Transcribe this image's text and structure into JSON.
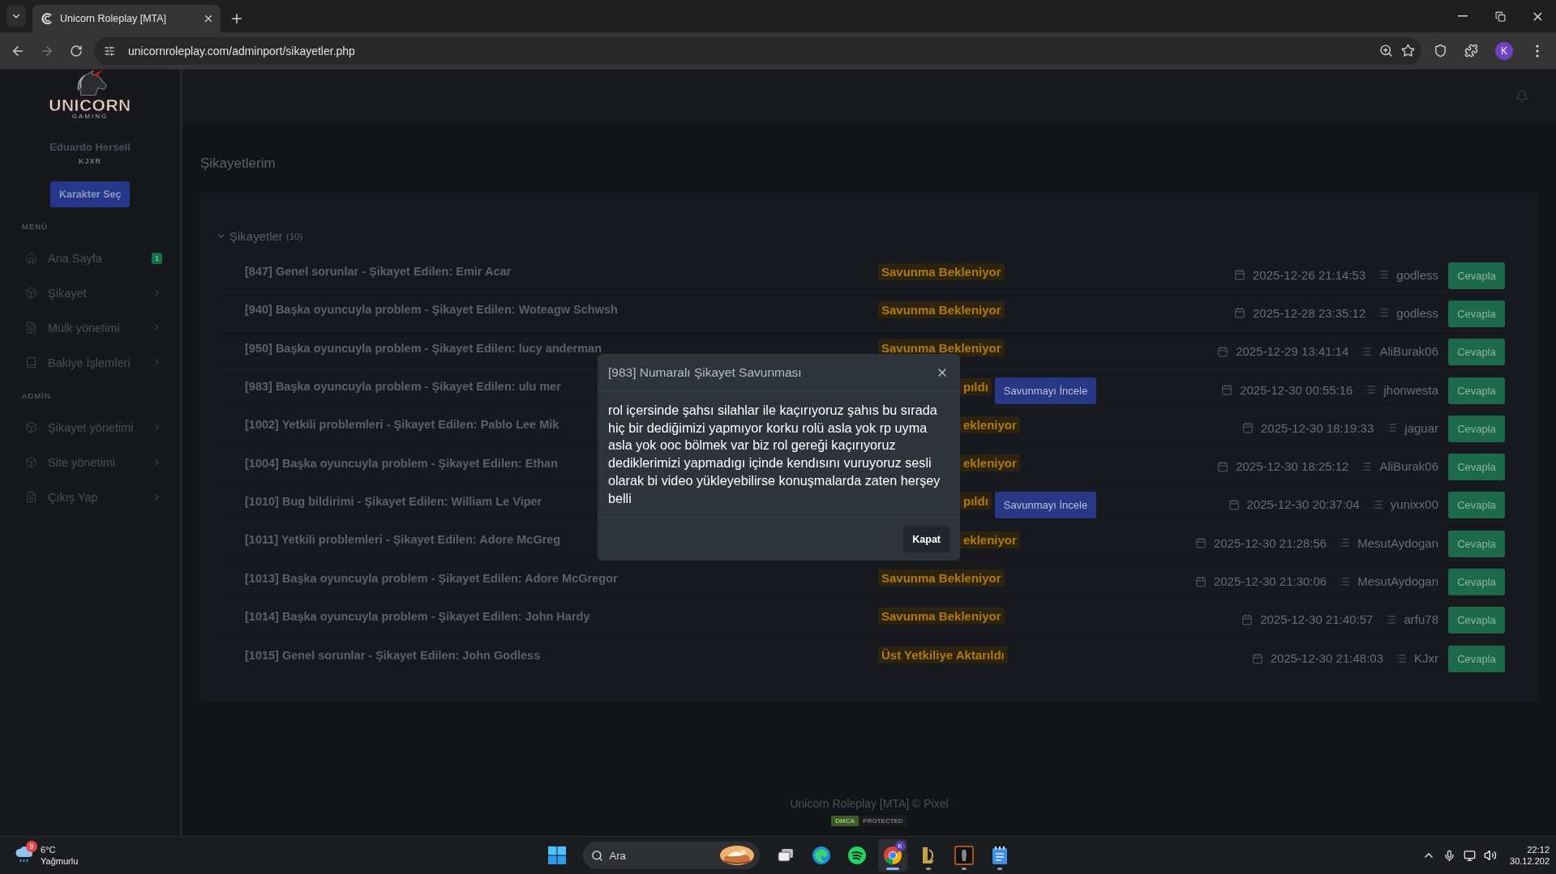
{
  "browser": {
    "tab_title": "Unicorn Roleplay [MTA]",
    "url": "unicornroleplay.com/adminport/sikayetler.php",
    "profile_initial": "K"
  },
  "sidebar": {
    "logo_text": "UNICORN",
    "logo_subtext": "GAMING",
    "user_name": "Eduardo Hersell",
    "user_tag": "KJXR",
    "select_button": "Karakter Seç",
    "sections": [
      {
        "heading": "MENÜ",
        "items": [
          {
            "label": "Ana Sayfa",
            "kind": "home",
            "badge": "1"
          },
          {
            "label": "Şikayet",
            "kind": "box"
          },
          {
            "label": "Mülk yönetimi",
            "kind": "file"
          },
          {
            "label": "Bakiye İşlemleri",
            "kind": "book"
          }
        ]
      },
      {
        "heading": "ADMİN",
        "items": [
          {
            "label": "Şikayet yönetimi",
            "kind": "box"
          },
          {
            "label": "Site yönetimi",
            "kind": "box"
          },
          {
            "label": "Çıkış Yap",
            "kind": "file"
          }
        ]
      }
    ]
  },
  "page_title": "Şikayetlerim",
  "complaints": {
    "heading": "Şikayetler",
    "count": "(10)",
    "expanded": true,
    "rows": [
      {
        "title": "[847] Genel sorunlar - Şikayet Edilen: Emir Acar",
        "status": "Savunma Bekleniyor",
        "status_clipped": false,
        "date": "2025-12-26 21:14:53",
        "user": "godless",
        "reply": "Cevapla"
      },
      {
        "title": "[940] Başka oyuncuyla problem - Şikayet Edilen: Woteagw Schwsh",
        "status": "Savunma Bekleniyor",
        "status_clipped": false,
        "date": "2025-12-28 23:35:12",
        "user": "godless",
        "reply": "Cevapla"
      },
      {
        "title": "[950] Başka oyuncuyla problem - Şikayet Edilen: lucy anderman",
        "status": "Savunma Bekleniyor",
        "status_clipped": false,
        "date": "2025-12-29 13:41:14",
        "user": "AliBurak06",
        "reply": "Cevapla"
      },
      {
        "title": "[983] Başka oyuncuyla problem - Şikayet Edilen: ulu mer",
        "status": "pıldı",
        "status_clipped": true,
        "action": "Savunmayı İncele",
        "date": "2025-12-30 00:55:16",
        "user": "jhonwesta",
        "reply": "Cevapla"
      },
      {
        "title": "[1002] Yetkili problemleri - Şikayet Edilen: Pablo Lee Mik",
        "status": "ekleniyor",
        "status_clipped": true,
        "date": "2025-12-30 18:19:33",
        "user": "jaguar",
        "reply": "Cevapla"
      },
      {
        "title": "[1004] Başka oyuncuyla problem - Şikayet Edilen: Ethan",
        "status": "ekleniyor",
        "status_clipped": true,
        "date": "2025-12-30 18:25:12",
        "user": "AliBurak06",
        "reply": "Cevapla"
      },
      {
        "title": "[1010] Bug bildirimi - Şikayet Edilen: William Le Viper",
        "status": "pıldı",
        "status_clipped": true,
        "action": "Savunmayı İncele",
        "date": "2025-12-30 20:37:04",
        "user": "yunixx00",
        "reply": "Cevapla"
      },
      {
        "title": "[1011] Yetkili problemleri - Şikayet Edilen: Adore McGreg",
        "status": "ekleniyor",
        "status_clipped": true,
        "date": "2025-12-30 21:28:56",
        "user": "MesutAydogan",
        "reply": "Cevapla"
      },
      {
        "title": "[1013] Başka oyuncuyla problem - Şikayet Edilen: Adore McGregor",
        "status": "Savunma Bekleniyor",
        "status_clipped": false,
        "date": "2025-12-30 21:30:06",
        "user": "MesutAydogan",
        "reply": "Cevapla"
      },
      {
        "title": "[1014] Başka oyuncuyla problem - Şikayet Edilen: John Hardy",
        "status": "Savunma Bekleniyor",
        "status_clipped": false,
        "date": "2025-12-30 21:40:57",
        "user": "arfu78",
        "reply": "Cevapla"
      },
      {
        "title": "[1015] Genel sorunlar - Şikayet Edilen: John Godless",
        "status": "Üst Yetkiliye Aktarıldı",
        "status_clipped": false,
        "date": "2025-12-30 21:48:03",
        "user": "KJxr",
        "reply": "Cevapla"
      }
    ]
  },
  "modal": {
    "title": "[983] Numaralı Şikayet Savunması",
    "body": "rol içersinde şahsı silahlar ile kaçırıyoruz şahıs bu sırada hiç bir dediğimizi yapmıyor korku rolü asla yok rp uyma asla yok ooc bölmek var biz rol gereği kaçırıyoruz dediklerimizi yapmadıgı içinde kendısını vuruyoruz sesli olarak bi video yükleyebilirse konuşmalarda zaten herşey belli",
    "close_button": "Kapat"
  },
  "footer": {
    "text": "Unicorn Roleplay [MTA] © Pixel",
    "badge_left": "DMCA",
    "badge_right": "PROTECTED"
  },
  "taskbar": {
    "weather": {
      "badge": "9",
      "temp": "6°C",
      "condition": "Yağmurlu"
    },
    "search": {
      "placeholder": "Ara"
    },
    "apps": [
      {
        "kind": "taskview",
        "running": false,
        "selected": false
      },
      {
        "kind": "edge",
        "running": false,
        "selected": false
      },
      {
        "kind": "spotify",
        "running": false,
        "selected": false
      },
      {
        "kind": "chrome",
        "running": true,
        "selected": true,
        "badge": "K"
      },
      {
        "kind": "emblem",
        "running": true,
        "selected": false
      },
      {
        "kind": "game",
        "running": true,
        "selected": false
      },
      {
        "kind": "notepad",
        "running": true,
        "selected": false
      }
    ],
    "clock": {
      "time": "22:12",
      "date": "30.12.202"
    }
  }
}
